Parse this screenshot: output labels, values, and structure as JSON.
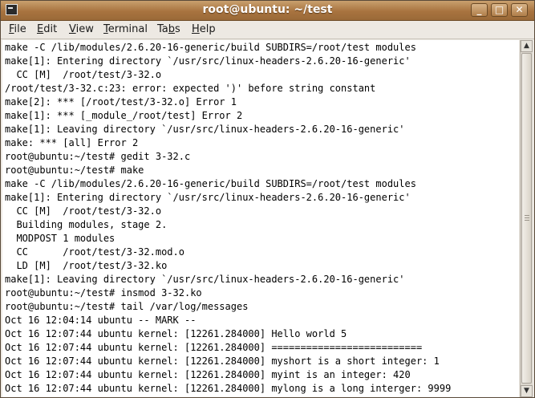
{
  "window": {
    "title": "root@ubuntu: ~/test"
  },
  "menu": [
    {
      "label": "File",
      "mnemonic": "F",
      "rest": "ile"
    },
    {
      "label": "Edit",
      "mnemonic": "E",
      "rest": "dit"
    },
    {
      "label": "View",
      "mnemonic": "V",
      "rest": "iew"
    },
    {
      "label": "Terminal",
      "mnemonic": "T",
      "rest": "erminal"
    },
    {
      "label": "Tabs",
      "mnemonic": "b",
      "pre": "Ta",
      "rest": "s"
    },
    {
      "label": "Help",
      "mnemonic": "H",
      "rest": "elp"
    }
  ],
  "terminal": {
    "lines": [
      "make -C /lib/modules/2.6.20-16-generic/build SUBDIRS=/root/test modules",
      "make[1]: Entering directory `/usr/src/linux-headers-2.6.20-16-generic'",
      "  CC [M]  /root/test/3-32.o",
      "/root/test/3-32.c:23: error: expected ')' before string constant",
      "make[2]: *** [/root/test/3-32.o] Error 1",
      "make[1]: *** [_module_/root/test] Error 2",
      "make[1]: Leaving directory `/usr/src/linux-headers-2.6.20-16-generic'",
      "make: *** [all] Error 2",
      "root@ubuntu:~/test# gedit 3-32.c",
      "root@ubuntu:~/test# make",
      "make -C /lib/modules/2.6.20-16-generic/build SUBDIRS=/root/test modules",
      "make[1]: Entering directory `/usr/src/linux-headers-2.6.20-16-generic'",
      "  CC [M]  /root/test/3-32.o",
      "  Building modules, stage 2.",
      "  MODPOST 1 modules",
      "  CC      /root/test/3-32.mod.o",
      "  LD [M]  /root/test/3-32.ko",
      "make[1]: Leaving directory `/usr/src/linux-headers-2.6.20-16-generic'",
      "root@ubuntu:~/test# insmod 3-32.ko",
      "root@ubuntu:~/test# tail /var/log/messages",
      "Oct 16 12:04:14 ubuntu -- MARK --",
      "Oct 16 12:07:44 ubuntu kernel: [12261.284000] Hello world 5",
      "Oct 16 12:07:44 ubuntu kernel: [12261.284000] ==========================",
      "Oct 16 12:07:44 ubuntu kernel: [12261.284000] myshort is a short integer: 1",
      "Oct 16 12:07:44 ubuntu kernel: [12261.284000] myint is an integer: 420",
      "Oct 16 12:07:44 ubuntu kernel: [12261.284000] mylong is a long interger: 9999"
    ]
  },
  "icons": {
    "window_icon": "terminal-icon",
    "minimize": "minimize-icon",
    "maximize": "maximize-icon",
    "close": "close-icon",
    "scroll_up": "arrow-up-icon",
    "scroll_down": "arrow-down-icon"
  }
}
